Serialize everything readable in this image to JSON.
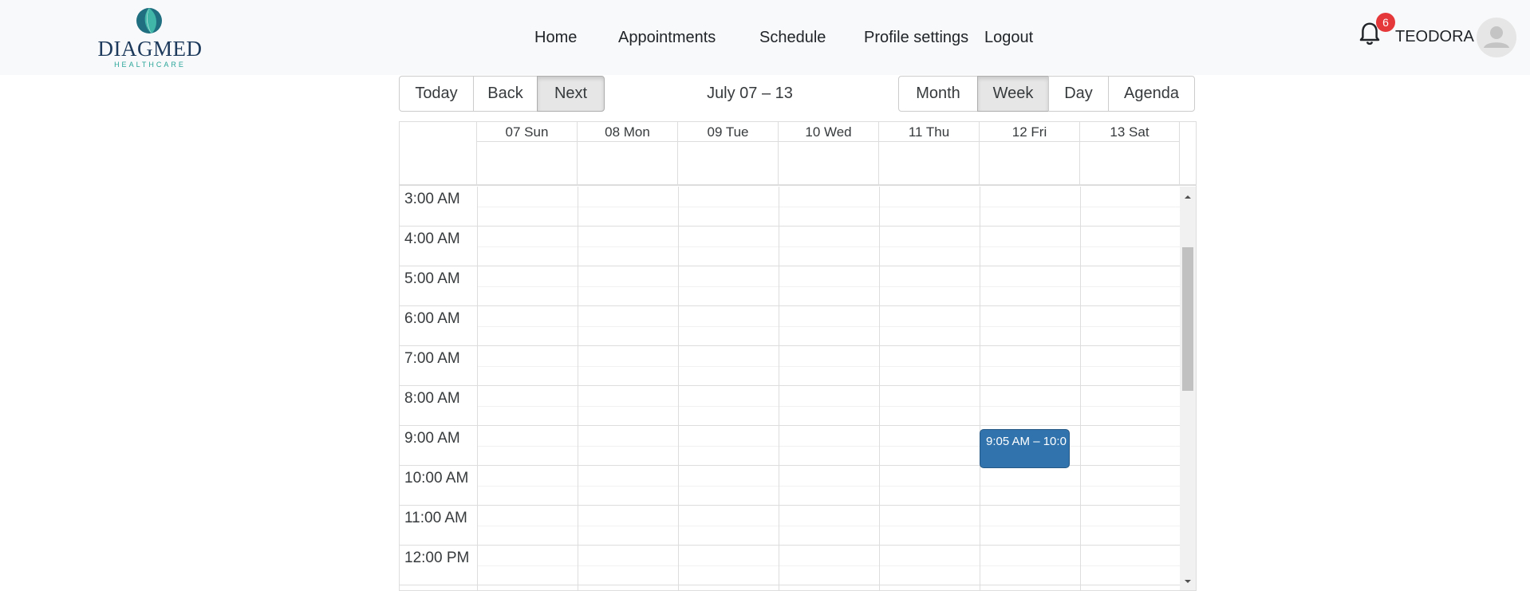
{
  "brand": {
    "name": "DIAGMED",
    "tagline": "HEALTHCARE"
  },
  "nav": [
    "Home",
    "Appointments",
    "Schedule",
    "Profile settings",
    "Logout"
  ],
  "user": {
    "name": "TEODORA",
    "notifications": "6"
  },
  "toolbar": {
    "nav_buttons": [
      "Today",
      "Back",
      "Next"
    ],
    "label": "July 07 – 13",
    "views": [
      "Month",
      "Week",
      "Day",
      "Agenda"
    ]
  },
  "calendar": {
    "days": [
      "07 Sun",
      "08 Mon",
      "09 Tue",
      "10 Wed",
      "11 Thu",
      "12 Fri",
      "13 Sat"
    ],
    "times": [
      "3:00 AM",
      "4:00 AM",
      "5:00 AM",
      "6:00 AM",
      "7:00 AM",
      "8:00 AM",
      "9:00 AM",
      "10:00 AM",
      "11:00 AM",
      "12:00 PM"
    ],
    "event": {
      "label": "9:05 AM – 10:0",
      "day": "12 Fri"
    }
  },
  "colors": {
    "event": "#3174ad",
    "badge": "#e5383b",
    "navbar_bg": "#f8f9fa",
    "active_btn": "#e6e6e6"
  }
}
